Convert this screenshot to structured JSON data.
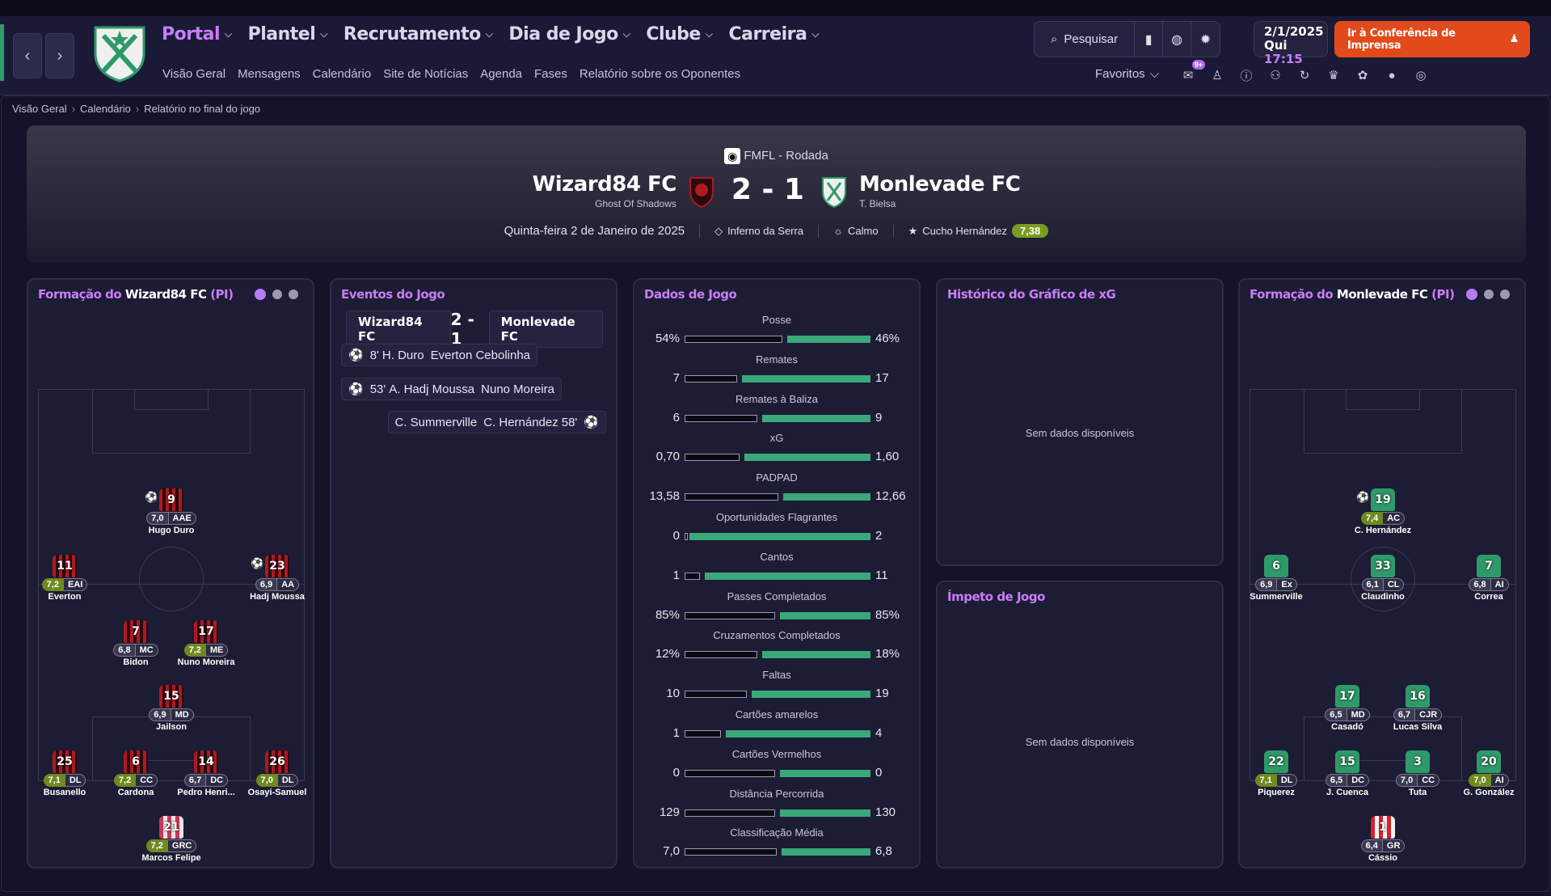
{
  "nav": {
    "menu": [
      {
        "label": "Portal",
        "active": true
      },
      {
        "label": "Plantel",
        "active": false
      },
      {
        "label": "Recrutamento",
        "active": false
      },
      {
        "label": "Dia de Jogo",
        "active": false
      },
      {
        "label": "Clube",
        "active": false
      },
      {
        "label": "Carreira",
        "active": false
      }
    ],
    "submenu": [
      "Visão Geral",
      "Mensagens",
      "Calendário",
      "Site de Notícias",
      "Agenda",
      "Fases",
      "Relatório sobre os Oponentes"
    ],
    "search_label": "Pesquisar",
    "date": "2/1/2025",
    "day": "Qui",
    "time": "17:15",
    "press_label": "Ir à Conferência de Imprensa",
    "favorites_label": "Favoritos",
    "notif_badge": "9+"
  },
  "breadcrumb": [
    "Visão Geral",
    "Calendário",
    "Relatório no final do jogo"
  ],
  "match": {
    "competition": "FMFL - Rodada",
    "home_team": "Wizard84 FC",
    "home_manager": "Ghost Of Shadows",
    "score": "2 - 1",
    "away_team": "Monlevade FC",
    "away_manager": "T. Bielsa",
    "date": "Quinta-feira 2 de Janeiro de 2025",
    "stadium": "Inferno da Serra",
    "weather": "Calmo",
    "motm": "Cucho Hernández",
    "motm_rating": "7,38"
  },
  "home_formation": {
    "title_prefix": "Formação do",
    "team": "Wizard84 FC",
    "suffix": "(PI)",
    "players": [
      {
        "num": "9",
        "rating": "7,0",
        "pos": "AAE",
        "name": "Hugo Duro",
        "goal": true,
        "good": false
      },
      {
        "num": "11",
        "rating": "7,2",
        "pos": "EAI",
        "name": "Everton",
        "goal": false,
        "good": true
      },
      {
        "num": "23",
        "rating": "6,9",
        "pos": "AA",
        "name": "Hadj Moussa",
        "goal": true,
        "good": false
      },
      {
        "num": "7",
        "rating": "6,8",
        "pos": "MC",
        "name": "Bidon",
        "goal": false,
        "good": false
      },
      {
        "num": "17",
        "rating": "7,2",
        "pos": "ME",
        "name": "Nuno Moreira",
        "goal": false,
        "good": true
      },
      {
        "num": "15",
        "rating": "6,9",
        "pos": "MD",
        "name": "Jailson",
        "goal": false,
        "good": false
      },
      {
        "num": "25",
        "rating": "7,1",
        "pos": "DL",
        "name": "Busanello",
        "goal": false,
        "good": true
      },
      {
        "num": "6",
        "rating": "7,2",
        "pos": "CC",
        "name": "Cardona",
        "goal": false,
        "good": true
      },
      {
        "num": "14",
        "rating": "6,7",
        "pos": "DC",
        "name": "Pedro Henri...",
        "goal": false,
        "good": false
      },
      {
        "num": "26",
        "rating": "7,0",
        "pos": "DL",
        "name": "Osayi-Samuel",
        "goal": false,
        "good": true
      },
      {
        "num": "21",
        "rating": "7,2",
        "pos": "GRC",
        "name": "Marcos Felipe",
        "goal": false,
        "good": true
      }
    ]
  },
  "away_formation": {
    "title_prefix": "Formação do",
    "team": "Monlevade FC",
    "suffix": "(PI)",
    "players": [
      {
        "num": "19",
        "rating": "7,4",
        "pos": "AC",
        "name": "C. Hernández",
        "goal": true,
        "good": true
      },
      {
        "num": "6",
        "rating": "6,9",
        "pos": "Ex",
        "name": "Summerville",
        "goal": false,
        "good": false
      },
      {
        "num": "33",
        "rating": "6,1",
        "pos": "CL",
        "name": "Claudinho",
        "goal": false,
        "good": false
      },
      {
        "num": "7",
        "rating": "6,8",
        "pos": "AI",
        "name": "Correa",
        "goal": false,
        "good": false
      },
      {
        "num": "17",
        "rating": "6,5",
        "pos": "MD",
        "name": "Casadó",
        "goal": false,
        "good": false
      },
      {
        "num": "16",
        "rating": "6,7",
        "pos": "CJR",
        "name": "Lucas Silva",
        "goal": false,
        "good": false
      },
      {
        "num": "22",
        "rating": "7,1",
        "pos": "DL",
        "name": "Piquerez",
        "goal": false,
        "good": true
      },
      {
        "num": "15",
        "rating": "6,5",
        "pos": "DC",
        "name": "J. Cuenca",
        "goal": false,
        "good": false
      },
      {
        "num": "3",
        "rating": "7,0",
        "pos": "CC",
        "name": "Tuta",
        "goal": false,
        "good": false
      },
      {
        "num": "20",
        "rating": "7,0",
        "pos": "AI",
        "name": "G. González",
        "goal": false,
        "good": true
      },
      {
        "num": "1",
        "rating": "6,4",
        "pos": "GR",
        "name": "Cássio",
        "goal": false,
        "good": false
      }
    ]
  },
  "events": {
    "title": "Eventos do Jogo",
    "home": "Wizard84 FC",
    "score": "2 - 1",
    "away": "Monlevade FC",
    "list": [
      {
        "side": "home",
        "minute": "8'",
        "scorer": "H. Duro",
        "assist": "Everton Cebolinha"
      },
      {
        "side": "home",
        "minute": "53'",
        "scorer": "A. Hadj Moussa",
        "assist": "Nuno Moreira"
      },
      {
        "side": "away",
        "minute": "58'",
        "scorer": "C. Hernández",
        "assist": "C. Summerville"
      }
    ]
  },
  "stats": {
    "title": "Dados de Jogo",
    "rows": [
      {
        "label": "Posse",
        "home": "54%",
        "away": "46%",
        "hv": 54,
        "av": 46
      },
      {
        "label": "Remates",
        "home": "7",
        "away": "17",
        "hv": 7,
        "av": 17
      },
      {
        "label": "Remates à Baliza",
        "home": "6",
        "away": "9",
        "hv": 6,
        "av": 9
      },
      {
        "label": "xG",
        "home": "0,70",
        "away": "1,60",
        "hv": 0.7,
        "av": 1.6
      },
      {
        "label": "PADPAD",
        "home": "13,58",
        "away": "12,66",
        "hv": 13.58,
        "av": 12.66
      },
      {
        "label": "Oportunidades Flagrantes",
        "home": "0",
        "away": "2",
        "hv": 0,
        "av": 2
      },
      {
        "label": "Cantos",
        "home": "1",
        "away": "11",
        "hv": 1,
        "av": 11
      },
      {
        "label": "Passes Completados",
        "home": "85%",
        "away": "85%",
        "hv": 85,
        "av": 85
      },
      {
        "label": "Cruzamentos Completados",
        "home": "12%",
        "away": "18%",
        "hv": 12,
        "av": 18
      },
      {
        "label": "Faltas",
        "home": "10",
        "away": "19",
        "hv": 10,
        "av": 19
      },
      {
        "label": "Cartões amarelos",
        "home": "1",
        "away": "4",
        "hv": 1,
        "av": 4
      },
      {
        "label": "Cartões Vermelhos",
        "home": "0",
        "away": "0",
        "hv": 0,
        "av": 0
      },
      {
        "label": "Distância Percorrida",
        "home": "129",
        "away": "130",
        "hv": 129,
        "av": 130
      },
      {
        "label": "Classificação Média",
        "home": "7,0",
        "away": "6,8",
        "hv": 7.0,
        "av": 6.8
      }
    ]
  },
  "xg_history": {
    "title": "Histórico do Gráfico de xG",
    "empty": "Sem dados disponíveis"
  },
  "momentum": {
    "title": "Ímpeto de Jogo",
    "empty": "Sem dados disponíveis"
  },
  "colors": {
    "accent": "#c97df5",
    "press": "#e24a1b",
    "home": "#b01822",
    "away": "#2e9a6a",
    "rating_good": "#6e8a20"
  },
  "icons": [
    "search-icon",
    "bookmark-icon",
    "globe-icon",
    "gear-icon",
    "press-icon",
    "ball-icon",
    "stadium-icon",
    "weather-icon",
    "star-icon"
  ]
}
